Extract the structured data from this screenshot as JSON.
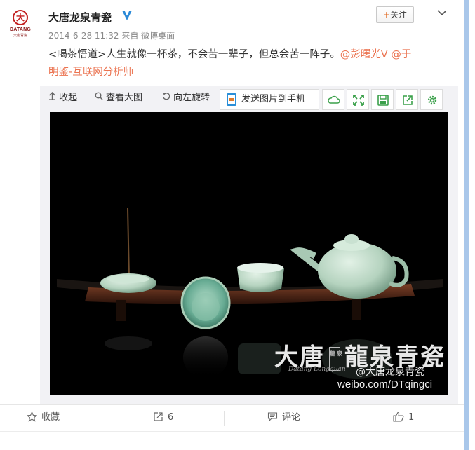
{
  "post": {
    "author": "大唐龙泉青瓷",
    "logo_en": "DATANG",
    "logo_cn": "大唐青瓷",
    "logo_seal": "大",
    "date": "2014-6-28 11:32",
    "source_prefix": "来自",
    "source": "微博桌面",
    "follow_plus": "+",
    "follow_label": "关注",
    "text_line1": "<喝茶悟道>人生就像一杯茶，不会苦一辈子，但总会苦一阵子。",
    "mention1": "@彭曙光V",
    "mention2_a": "@于",
    "mention2_b": "明鉴-互联网分析师"
  },
  "media_toolbar": {
    "collapse": "收起",
    "view_large": "查看大图",
    "rotate_left": "向左旋转",
    "send_to_phone": "发送图片到手机"
  },
  "watermark": {
    "brand": "大唐",
    "seal": "龍泉",
    "brand2": "龍泉青瓷",
    "script": "Datang Longquan",
    "handle": "@大唐龙泉青瓷",
    "url": "weibo.com/DTqingci"
  },
  "footer": {
    "favorite": "收藏",
    "repost_count": "6",
    "comment": "评论",
    "like_count": "1"
  },
  "colors": {
    "link": "#eb7350",
    "verified": "#2b8ad8",
    "toolbar_green": "#3aa04a",
    "right_edge": "#a9c7ea"
  }
}
